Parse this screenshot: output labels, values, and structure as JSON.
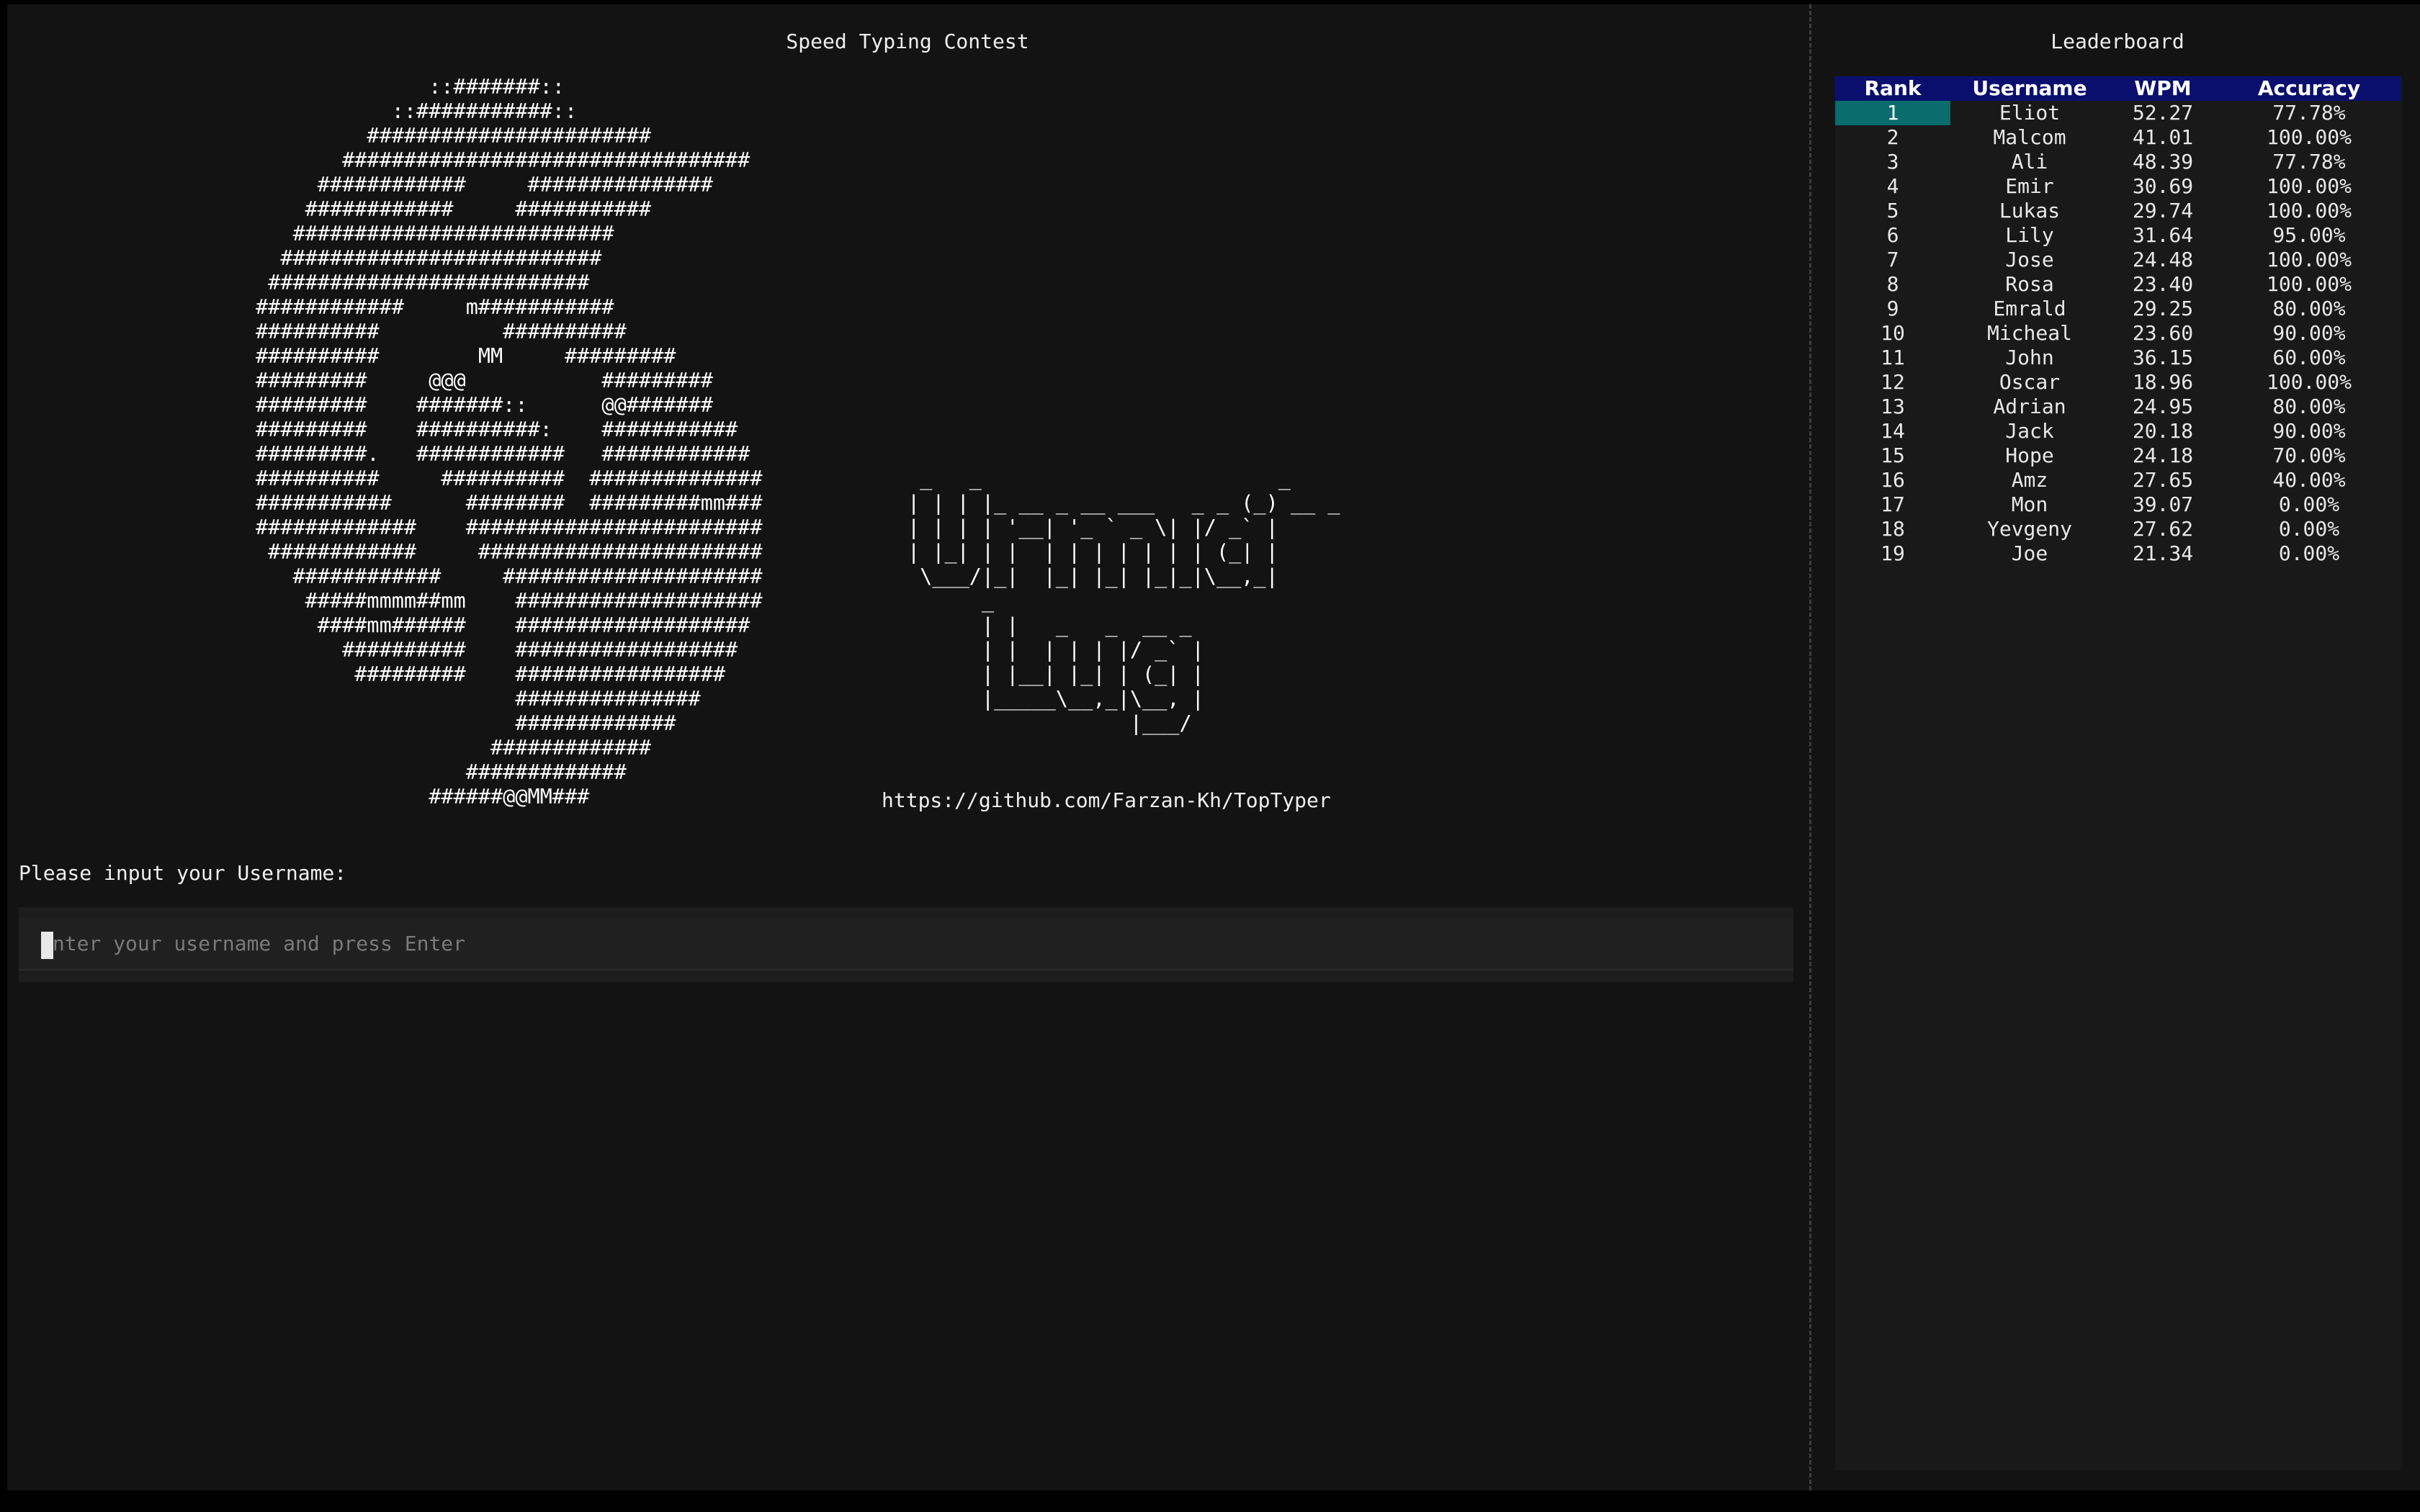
{
  "app": {
    "title": "Speed Typing Contest"
  },
  "logo": {
    "ascii_art": "              ::#######::\n           ::###########::\n         #######################\n       #################################\n     ############     ###############\n    ############     ###########\n   ##########################\n  ##########################\n ##########################\n############     m###########\n##########          ##########\n##########        MM     #########\n#########     @@@           #########\n#########    #######::      @@#######\n#########    ##########:    ###########\n#########.   ############   ############\n##########     ##########  ##############\n###########      ########  #########mm###\n#############    ########################\n ############     #######################\n   ############     #####################\n    #####mmmm##mm    ####################\n     ####mm######    ###################\n       ##########    ##################\n        #########    #################\n                     ###############\n                     #############\n                   #############\n                 #############\n              ######@@MM###",
    "ascii_name": " _   _                        _\n| | | |_ __ _ __ ___   _ _ (_) __ _\n| | | | '__| '_ ` _ \\| |/ _` |\n| |_| | |  | | | | | | | (_| |\n \\___/|_|  |_| |_| |_|_|\\__,_|\n      _\n      | |   _   _  __ _\n      | |  | | | |/ _` |\n      | |__| |_| | (_| |\n      |_____\\__,_|\\__, |\n                  |___/",
    "repo_url": "https://github.com/Farzan-Kh/TopTyper"
  },
  "login": {
    "prompt": "Please input your Username:",
    "placeholder": "Enter your username and press Enter",
    "value": ""
  },
  "leaderboard": {
    "title": "Leaderboard",
    "columns": [
      "Rank",
      "Username",
      "WPM",
      "Accuracy"
    ],
    "selected_rank": 1,
    "rows": [
      {
        "rank": "1",
        "username": "Eliot",
        "wpm": "52.27",
        "accuracy": "77.78%"
      },
      {
        "rank": "2",
        "username": "Malcom",
        "wpm": "41.01",
        "accuracy": "100.00%"
      },
      {
        "rank": "3",
        "username": "Ali",
        "wpm": "48.39",
        "accuracy": "77.78%"
      },
      {
        "rank": "4",
        "username": "Emir",
        "wpm": "30.69",
        "accuracy": "100.00%"
      },
      {
        "rank": "5",
        "username": "Lukas",
        "wpm": "29.74",
        "accuracy": "100.00%"
      },
      {
        "rank": "6",
        "username": "Lily",
        "wpm": "31.64",
        "accuracy": "95.00%"
      },
      {
        "rank": "7",
        "username": "Jose",
        "wpm": "24.48",
        "accuracy": "100.00%"
      },
      {
        "rank": "8",
        "username": "Rosa",
        "wpm": "23.40",
        "accuracy": "100.00%"
      },
      {
        "rank": "9",
        "username": "Emrald",
        "wpm": "29.25",
        "accuracy": "80.00%"
      },
      {
        "rank": "10",
        "username": "Micheal",
        "wpm": "23.60",
        "accuracy": "90.00%"
      },
      {
        "rank": "11",
        "username": "John",
        "wpm": "36.15",
        "accuracy": "60.00%"
      },
      {
        "rank": "12",
        "username": "Oscar",
        "wpm": "18.96",
        "accuracy": "100.00%"
      },
      {
        "rank": "13",
        "username": "Adrian",
        "wpm": "24.95",
        "accuracy": "80.00%"
      },
      {
        "rank": "14",
        "username": "Jack",
        "wpm": "20.18",
        "accuracy": "90.00%"
      },
      {
        "rank": "15",
        "username": "Hope",
        "wpm": "24.18",
        "accuracy": "70.00%"
      },
      {
        "rank": "16",
        "username": "Amz",
        "wpm": "27.65",
        "accuracy": "40.00%"
      },
      {
        "rank": "17",
        "username": "Mon",
        "wpm": "39.07",
        "accuracy": "0.00%"
      },
      {
        "rank": "18",
        "username": "Yevgeny",
        "wpm": "27.62",
        "accuracy": "0.00%"
      },
      {
        "rank": "19",
        "username": "Joe",
        "wpm": "21.34",
        "accuracy": "0.00%"
      }
    ]
  },
  "colors": {
    "header_bg": "#0a0f6e",
    "selected_cell": "#0a6c6c",
    "background": "#131313"
  }
}
